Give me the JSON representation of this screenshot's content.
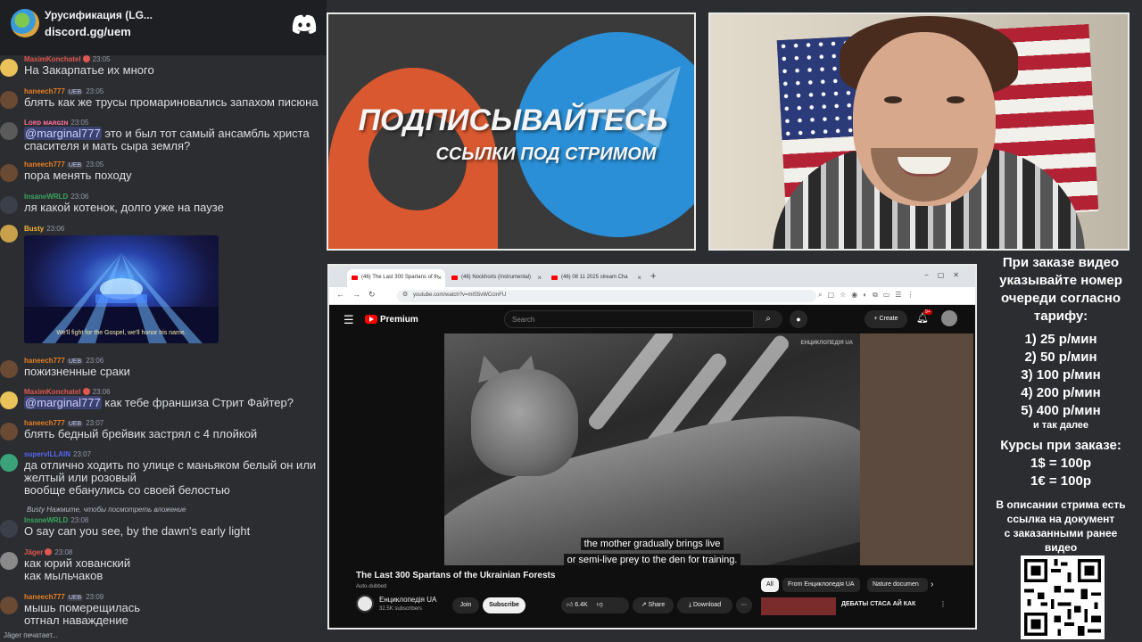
{
  "chat": {
    "server_name": "Урусификация (LG...",
    "server_link": "discord.gg/uem",
    "messages": [
      {
        "author": "MaximKonchatel",
        "color": "#e0574f",
        "tag": "",
        "time": "23:05",
        "text": "На Закарпатье их много",
        "avatar": "#e9c35a"
      },
      {
        "author": "haneech777",
        "color": "#e67e22",
        "tag": "UEB",
        "time": "23:05",
        "text": "блять как же трусы промариновались запахом писюна",
        "avatar": "#6b4a33"
      },
      {
        "author": "Lᴏʀᴅ ᴍᴀʀɢɪɴ",
        "color": "#ff6e9c",
        "tag": "",
        "time": "23:05",
        "mention": "@marginal777",
        "text": " это и был тот самый ансамбль христа\nспасителя и мать сыра земля?",
        "avatar": "#5a5a5a"
      },
      {
        "author": "haneech777",
        "color": "#e67e22",
        "tag": "UEB",
        "time": "23:05",
        "text": "пора менять походу",
        "avatar": "#6b4a33"
      },
      {
        "author": "InsaneWRLD",
        "color": "#3ba55d",
        "tag": "",
        "time": "23:06",
        "text": "ля какой котенок, долго уже на паузе",
        "avatar": "#3a3f4a"
      },
      {
        "author": "Busty",
        "color": "#f0b232",
        "tag": "",
        "time": "23:06",
        "text": "",
        "avatar": "#c9a14a"
      },
      {
        "author": "haneech777",
        "color": "#e67e22",
        "tag": "UEB",
        "time": "23:06",
        "text": "пожизненные сраки",
        "avatar": "#6b4a33"
      },
      {
        "author": "MaximKonchatel",
        "color": "#e0574f",
        "tag": "",
        "time": "23:06",
        "mention": "@marginal777",
        "text": " как тебе франшиза Стрит Файтер?",
        "avatar": "#e9c35a"
      },
      {
        "author": "haneech777",
        "color": "#e67e22",
        "tag": "UEB",
        "time": "23:07",
        "text": "блять бедный брейвик застрял с 4 плойкой",
        "avatar": "#6b4a33"
      },
      {
        "author": "supervILLAIN",
        "color": "#5865f2",
        "tag": "",
        "time": "23:07",
        "text": "да отлично ходить по улице с маньяком белый он или\nжелтый или розовый\nвообще ебанулись со своей белостью",
        "avatar": "#3aa37a"
      },
      {
        "author": "InsaneWRLD",
        "color": "#3ba55d",
        "tag": "",
        "time": "23:08",
        "text": "O say can you see, by the dawn's early light",
        "avatar": "#3a3f4a"
      },
      {
        "author": "Jäger",
        "color": "#e0574f",
        "tag": "",
        "time": "23:08",
        "text": "как юрий хованский\nкак мыльчаков",
        "avatar": "#8a8a8a"
      },
      {
        "author": "haneech777",
        "color": "#e67e22",
        "tag": "UEB",
        "time": "23:09",
        "text": "мышь померещилась\nотгнал наваждение",
        "avatar": "#6b4a33"
      }
    ],
    "image_caption": "We'll fight for the Gospel, we'll honor his name.",
    "reply_hint": "Busty Нажмите, чтобы посмотреть вложение",
    "typing": "Jäger печатает..."
  },
  "banner": {
    "title": "ПОДПИСЫВАЙТЕСЬ",
    "subtitle": "ССЫЛКИ ПОД СТРИМОМ"
  },
  "browser": {
    "tabs": [
      {
        "label": "(46) The Last 300 Spartans of th"
      },
      {
        "label": "(46) Nockhorts (Instrumental)"
      },
      {
        "label": "(46) 08 11 2025 stream Cha"
      }
    ],
    "url": "youtube.com/watch?v=mlS5vWCcmFU"
  },
  "youtube": {
    "brand": "Premium",
    "search_placeholder": "Search",
    "create_label": "Create",
    "notifications": "9+",
    "watermark": "ЕНЦИКЛОПЕДІЯ UA",
    "subtitle_line1": "the mother gradually brings live",
    "subtitle_line2": "or semi-live prey to the den for training.",
    "video_title": "The Last 300 Spartans of the Ukrainian Forests",
    "auto_dubbed": "Auto-dubbed",
    "channel_name": "Енциклопедія UA",
    "channel_subs": "32.5K subscribers",
    "join_label": "Join",
    "subscribe_label": "Subscribe",
    "likes": "6.4K",
    "share_label": "Share",
    "download_label": "Download",
    "chips": [
      "All",
      "From Енциклопедія UA",
      "Nature documen"
    ],
    "rec_title": "ДЕБАТЫ СТАСА АЙ КАК"
  },
  "info": {
    "intro": [
      "При заказе видео",
      "указывайте номер",
      "очереди согласно",
      "тарифу:"
    ],
    "rates": [
      "1) 25 р/мин",
      "2) 50 р/мин",
      "3) 100 р/мин",
      "4) 200 р/мин",
      "5) 400 р/мин"
    ],
    "etc": "и так далее",
    "courses_title": "Курсы при заказе:",
    "course_usd": "1$ = 100р",
    "course_eur": "1€ = 100р",
    "desc": [
      "В описании стрима есть",
      "ссылка на документ",
      "с заказанными ранее",
      "видео"
    ]
  }
}
